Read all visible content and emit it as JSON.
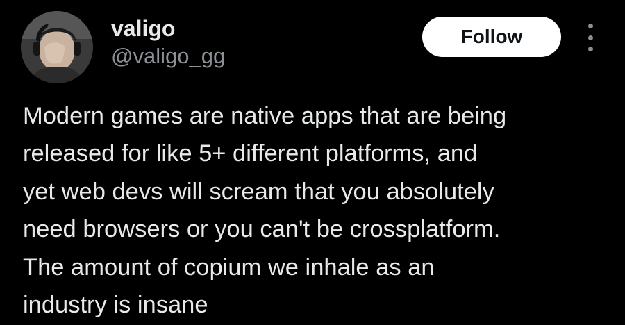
{
  "author": {
    "display_name": "valigo",
    "handle": "@valigo_gg",
    "avatar_icon": "user-avatar"
  },
  "actions": {
    "follow_label": "Follow",
    "more_icon": "vertical-ellipsis-icon"
  },
  "tweet": {
    "lines": [
      "Modern games are native apps that are being",
      "released for like 5+ different platforms, and",
      "yet web devs will scream that you absolutely",
      "need browsers or you can't be crossplatform.",
      "The amount of copium we inhale as an",
      "industry is insane"
    ]
  },
  "colors": {
    "background": "#000000",
    "primary_text": "#e7e9ea",
    "secondary_text": "#8b9096",
    "button_bg": "#ffffff",
    "button_text": "#0f1419"
  }
}
